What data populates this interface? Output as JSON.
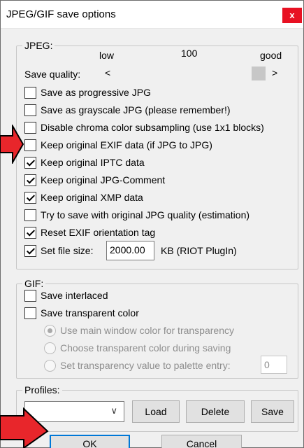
{
  "window": {
    "title": "JPEG/GIF save options",
    "close_glyph": "x"
  },
  "jpeg": {
    "group_label": "JPEG:",
    "quality_low": "low",
    "quality_value": "100",
    "quality_good": "good",
    "save_quality_label": "Save quality:",
    "slider_left_glyph": "<",
    "slider_right_glyph": ">",
    "options": [
      {
        "label": "Save as progressive JPG",
        "checked": false
      },
      {
        "label": "Save as grayscale JPG (please remember!)",
        "checked": false
      },
      {
        "label": "Disable chroma color subsampling (use 1x1 blocks)",
        "checked": false
      },
      {
        "label": "Keep original EXIF data (if JPG to JPG)",
        "checked": false
      },
      {
        "label": "Keep original IPTC data",
        "checked": true
      },
      {
        "label": "Keep original JPG-Comment",
        "checked": true
      },
      {
        "label": "Keep original XMP data",
        "checked": true
      },
      {
        "label": "Try to save with original JPG quality (estimation)",
        "checked": false
      },
      {
        "label": "Reset EXIF orientation tag",
        "checked": true
      }
    ],
    "set_file_size": {
      "label": "Set file size:",
      "checked": true,
      "value": "2000.00",
      "suffix": "KB (RIOT PlugIn)"
    }
  },
  "gif": {
    "group_label": "GIF:",
    "save_interlaced": "Save interlaced",
    "save_transparent": "Save transparent color",
    "radios": [
      {
        "label": "Use main window color for transparency",
        "checked": true
      },
      {
        "label": "Choose transparent color during saving",
        "checked": false
      },
      {
        "label": "Set transparency value to palette entry:",
        "checked": false
      }
    ],
    "palette_entry_value": "0"
  },
  "profiles": {
    "group_label": "Profiles:",
    "dropdown_value": "",
    "load_label": "Load",
    "delete_label": "Delete",
    "save_label": "Save"
  },
  "footer": {
    "ok_label": "OK",
    "cancel_label": "Cancel"
  },
  "colors": {
    "close_red": "#e81123",
    "accent": "#0078d7",
    "annotation_arrow": "#e8262b"
  }
}
